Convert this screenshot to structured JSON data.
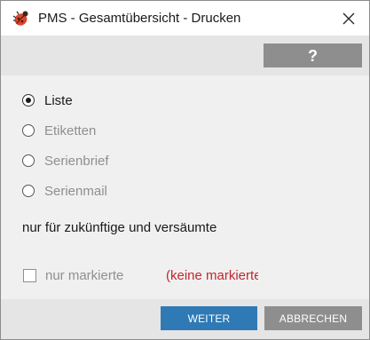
{
  "window": {
    "title": "PMS - Gesamtübersicht - Drucken",
    "close_icon": "close-icon",
    "app_icon": "ladybug-icon"
  },
  "toolbar": {
    "help_label": "?"
  },
  "options": [
    {
      "label": "Liste",
      "selected": true,
      "enabled": true
    },
    {
      "label": "Etiketten",
      "selected": false,
      "enabled": false
    },
    {
      "label": "Serienbrief",
      "selected": false,
      "enabled": false
    },
    {
      "label": "Serienmail",
      "selected": false,
      "enabled": false
    }
  ],
  "note": "nur für zukünftige und versäumte",
  "marked_only": {
    "label": "nur markierte",
    "checked": false,
    "enabled": false,
    "info": "(keine markierten)"
  },
  "footer": {
    "continue_label": "WEITER",
    "cancel_label": "ABBRECHEN"
  },
  "colors": {
    "primary": "#2f7ab5",
    "secondary": "#8e8e8e",
    "warning_text": "#c0282f"
  }
}
